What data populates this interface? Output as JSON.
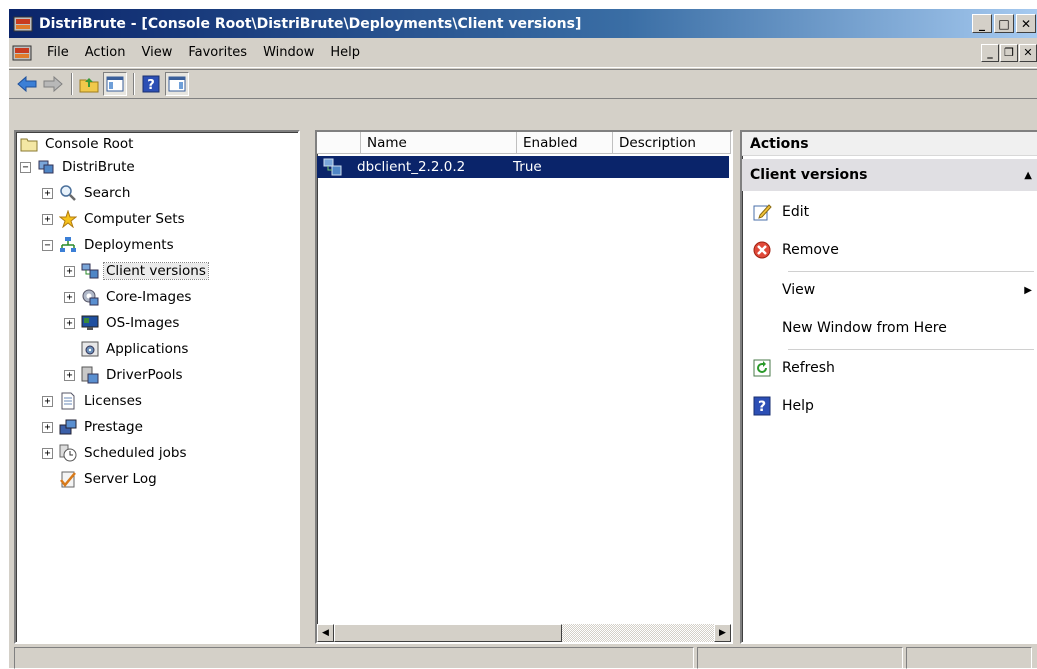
{
  "window": {
    "title": "DistriBrute - [Console Root\\DistriBrute\\Deployments\\Client versions]",
    "caption_buttons": {
      "minimize": "_",
      "maximize": "□",
      "close": "✕"
    }
  },
  "menu": {
    "items": [
      "File",
      "Action",
      "View",
      "Favorites",
      "Window",
      "Help"
    ],
    "mdi_buttons": {
      "minimize": "_",
      "restore": "❐",
      "close": "✕"
    }
  },
  "toolbar": {
    "icons": [
      "back-arrow-icon",
      "forward-arrow-icon",
      "up-folder-icon",
      "show-hide-tree-icon",
      "help-icon",
      "show-hide-action-pane-icon"
    ]
  },
  "tree": {
    "root": "Console Root",
    "app": "DistriBrute",
    "items": {
      "search": "Search",
      "computer_sets": "Computer Sets",
      "deployments": "Deployments",
      "client_versions": "Client versions",
      "core_images": "Core-Images",
      "os_images": "OS-Images",
      "applications": "Applications",
      "driver_pools": "DriverPools",
      "licenses": "Licenses",
      "prestage": "Prestage",
      "scheduled_jobs": "Scheduled jobs",
      "server_log": "Server Log"
    },
    "expander_plus": "+",
    "expander_minus": "−"
  },
  "list": {
    "columns": [
      "Name",
      "Enabled",
      "Description"
    ],
    "rows": [
      {
        "name": "dbclient_2.2.0.2",
        "enabled": "True",
        "description": ""
      }
    ]
  },
  "actions": {
    "header": "Actions",
    "section": "Client versions",
    "items": {
      "edit": "Edit",
      "remove": "Remove",
      "view": "View",
      "new_window": "New Window from Here",
      "refresh": "Refresh",
      "help": "Help"
    }
  },
  "colors": {
    "selection": "#0a246a",
    "title_gradient_start": "#0a246a",
    "chrome": "#d4d0c8"
  }
}
